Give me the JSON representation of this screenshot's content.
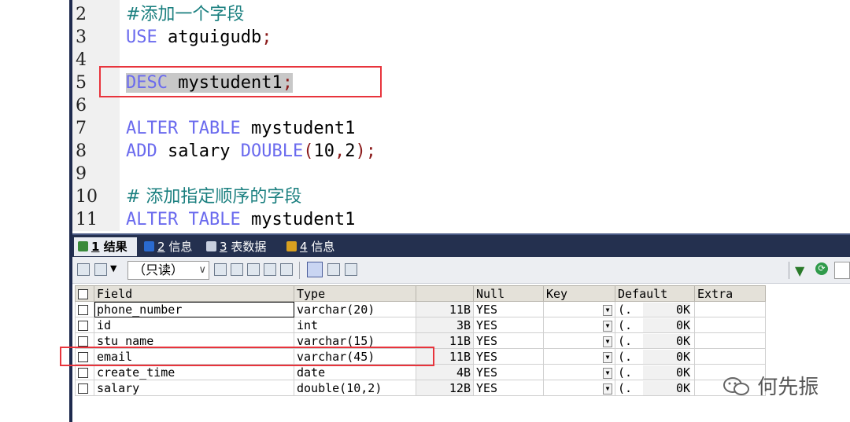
{
  "editor": {
    "lines": [
      {
        "num": "2",
        "tokens": [
          {
            "t": "#添加一个字段",
            "c": "cm"
          }
        ]
      },
      {
        "num": "3",
        "tokens": [
          {
            "t": "USE",
            "c": "kw"
          },
          {
            "t": " atguigudb",
            "c": "id"
          },
          {
            "t": ";",
            "c": "pn"
          }
        ]
      },
      {
        "num": "4",
        "tokens": []
      },
      {
        "num": "5",
        "tokens": [
          {
            "t": "DESC",
            "c": "kw sel"
          },
          {
            "t": " mystudent1",
            "c": "id sel"
          },
          {
            "t": ";",
            "c": "pn sel"
          }
        ]
      },
      {
        "num": "6",
        "tokens": []
      },
      {
        "num": "7",
        "tokens": [
          {
            "t": "ALTER TABLE",
            "c": "kw"
          },
          {
            "t": " mystudent1",
            "c": "id"
          }
        ]
      },
      {
        "num": "8",
        "tokens": [
          {
            "t": "ADD",
            "c": "kw"
          },
          {
            "t": " salary ",
            "c": "id"
          },
          {
            "t": "DOUBLE",
            "c": "kw"
          },
          {
            "t": "(",
            "c": "pn"
          },
          {
            "t": "10",
            "c": "id"
          },
          {
            "t": ",",
            "c": "pn"
          },
          {
            "t": "2",
            "c": "id"
          },
          {
            "t": ");",
            "c": "pn"
          }
        ]
      },
      {
        "num": "9",
        "tokens": []
      },
      {
        "num": "10",
        "tokens": [
          {
            "t": "# 添加指定顺序的字段",
            "c": "cm"
          }
        ]
      },
      {
        "num": "11",
        "tokens": [
          {
            "t": "ALTER TABLE",
            "c": "kw"
          },
          {
            "t": " mystudent1",
            "c": "id"
          }
        ]
      }
    ]
  },
  "tabs": [
    {
      "num": "1",
      "label": "结果",
      "active": true,
      "icon": "result-grid-icon",
      "color": "#3a8a3a"
    },
    {
      "num": "2",
      "label": "信息",
      "active": false,
      "icon": "info-icon",
      "color": "#2a6ad0"
    },
    {
      "num": "3",
      "label": "表数据",
      "active": false,
      "icon": "table-data-icon",
      "color": "#c8d0e0"
    },
    {
      "num": "4",
      "label": "信息",
      "active": false,
      "icon": "info-alert-icon",
      "color": "#d8a020"
    }
  ],
  "toolbar": {
    "readonly_label": "（只读）",
    "dropdown_glyph": "∨"
  },
  "results": {
    "headers": [
      "Field",
      "Type",
      "",
      "Null",
      "Key",
      "Default",
      "Extra"
    ],
    "rows": [
      {
        "field": "phone_number",
        "type": "varchar(20)",
        "size": "11B",
        "null": "YES",
        "key": "",
        "default_prefix": "(.",
        "default": "0K",
        "extra": ""
      },
      {
        "field": "id",
        "type": "int",
        "size": "3B",
        "null": "YES",
        "key": "",
        "default_prefix": "(.",
        "default": "0K",
        "extra": ""
      },
      {
        "field": "stu_name",
        "type": "varchar(15)",
        "size": "11B",
        "null": "YES",
        "key": "",
        "default_prefix": "(.",
        "default": "0K",
        "extra": ""
      },
      {
        "field": "email",
        "type": "varchar(45)",
        "size": "11B",
        "null": "YES",
        "key": "",
        "default_prefix": "(.",
        "default": "0K",
        "extra": ""
      },
      {
        "field": "create_time",
        "type": "date",
        "size": "4B",
        "null": "YES",
        "key": "",
        "default_prefix": "(.",
        "default": "0K",
        "extra": ""
      },
      {
        "field": "salary",
        "type": "double(10,2)",
        "size": "12B",
        "null": "YES",
        "key": "",
        "default_prefix": "(.",
        "default": "0K",
        "extra": ""
      }
    ]
  },
  "watermark": {
    "text": "何先振"
  },
  "colors": {
    "highlight_box": "#e8343c",
    "keyword": "#6a6aee",
    "comment": "#1a7f7f"
  }
}
